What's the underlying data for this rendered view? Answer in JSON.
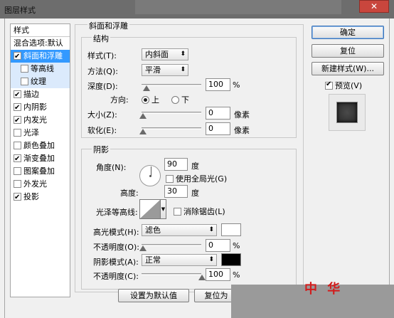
{
  "window": {
    "title": "图层样式"
  },
  "left_panel": {
    "header": "样式",
    "items": [
      {
        "label": "混合选项:默认",
        "checkbox": false,
        "checked": false,
        "selected": false,
        "sub": false
      },
      {
        "label": "斜面和浮雕",
        "checkbox": true,
        "checked": true,
        "selected": true,
        "sub": false
      },
      {
        "label": "等高线",
        "checkbox": true,
        "checked": false,
        "selected": false,
        "sub": true
      },
      {
        "label": "纹理",
        "checkbox": true,
        "checked": false,
        "selected": false,
        "sub": true
      },
      {
        "label": "描边",
        "checkbox": true,
        "checked": true,
        "selected": false,
        "sub": false
      },
      {
        "label": "内阴影",
        "checkbox": true,
        "checked": true,
        "selected": false,
        "sub": false
      },
      {
        "label": "内发光",
        "checkbox": true,
        "checked": true,
        "selected": false,
        "sub": false
      },
      {
        "label": "光泽",
        "checkbox": true,
        "checked": false,
        "selected": false,
        "sub": false
      },
      {
        "label": "颜色叠加",
        "checkbox": true,
        "checked": false,
        "selected": false,
        "sub": false
      },
      {
        "label": "渐变叠加",
        "checkbox": true,
        "checked": true,
        "selected": false,
        "sub": false
      },
      {
        "label": "图案叠加",
        "checkbox": true,
        "checked": false,
        "selected": false,
        "sub": false
      },
      {
        "label": "外发光",
        "checkbox": true,
        "checked": false,
        "selected": false,
        "sub": false
      },
      {
        "label": "投影",
        "checkbox": true,
        "checked": true,
        "selected": false,
        "sub": false
      }
    ]
  },
  "bevel": {
    "section_title": "斜面和浮雕",
    "structure": {
      "title": "结构",
      "style_label": "样式(T):",
      "style_value": "内斜面",
      "method_label": "方法(Q):",
      "method_value": "平滑",
      "depth_label": "深度(D):",
      "depth_value": "100",
      "depth_unit": "%",
      "direction_label": "方向:",
      "direction_up": "上",
      "direction_down": "下",
      "size_label": "大小(Z):",
      "size_value": "0",
      "size_unit": "像素",
      "soften_label": "软化(E):",
      "soften_value": "0",
      "soften_unit": "像素"
    },
    "shading": {
      "title": "阴影",
      "angle_label": "角度(N):",
      "angle_value": "90",
      "angle_unit": "度",
      "global_light_label": "使用全局光(G)",
      "altitude_label": "高度:",
      "altitude_value": "30",
      "altitude_unit": "度",
      "gloss_contour_label": "光泽等高线:",
      "anti_alias_label": "消除锯齿(L)",
      "highlight_mode_label": "高光模式(H):",
      "highlight_mode_value": "滤色",
      "highlight_color": "#ffffff",
      "highlight_opacity_label": "不透明度(O):",
      "highlight_opacity_value": "0",
      "highlight_opacity_unit": "%",
      "shadow_mode_label": "阴影模式(A):",
      "shadow_mode_value": "正常",
      "shadow_color": "#000000",
      "shadow_opacity_label": "不透明度(C):",
      "shadow_opacity_value": "100",
      "shadow_opacity_unit": "%"
    },
    "bottom_buttons": {
      "default": "设置为默认值",
      "reset": "复位为"
    }
  },
  "right_buttons": {
    "ok": "确定",
    "reset": "复位",
    "new_style": "新建样式(W)...",
    "preview_label": "预览(V)"
  },
  "watermark": "中 华"
}
